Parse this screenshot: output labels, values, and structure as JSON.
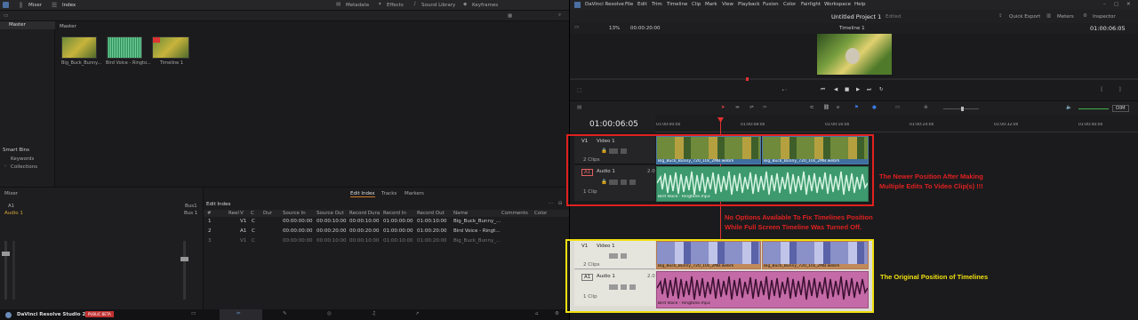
{
  "left_app": {
    "topbar": {
      "mixer": "Mixer",
      "index": "Index",
      "metadata": "Metadata",
      "effects": "Effects",
      "sound_library": "Sound Library",
      "keyframes": "Keyframes"
    },
    "master": "Master",
    "media_header": "Master",
    "clips": [
      {
        "name": "Big_Buck_Bunny..."
      },
      {
        "name": "Bird Voice - Ringto..."
      },
      {
        "name": "Timeline 1"
      }
    ],
    "smart_bins": "Smart Bins",
    "keywords": "Keywords",
    "collections": "Collections",
    "mixer_label": "Mixer",
    "a1": "A1",
    "audio1": "Audio 1",
    "bus1": "Bus1",
    "bus1b": "Bus 1",
    "edit_index": {
      "title": "Edit Index",
      "tabs": [
        "Edit Index",
        "Tracks",
        "Markers"
      ],
      "columns": [
        "#",
        "Reel",
        "V",
        "C",
        "Dur",
        "Source In",
        "Source Out",
        "Record Duratio",
        "Record In",
        "Record Out",
        "Name",
        "Comments",
        "Color"
      ],
      "rows": [
        [
          "1",
          "",
          "V1",
          "C",
          "",
          "00:00:00:00",
          "00:00:10:00",
          "00:00:10:00",
          "01:00:00:00",
          "01:00:10:00",
          "Big_Buck_Bunny_..."
        ],
        [
          "2",
          "",
          "A1",
          "C",
          "",
          "00:00:00:00",
          "00:00:20:00",
          "00:00:20:00",
          "01:00:00:00",
          "01:00:20:00",
          "Bird Voice - Ringt..."
        ],
        [
          "3",
          "",
          "V1",
          "C",
          "",
          "00:00:00:00",
          "00:00:10:00",
          "00:00:10:00",
          "01:00:10:00",
          "01:00:20:00",
          "Big_Buck_Bunny_..."
        ]
      ]
    },
    "brand": "DaVinci Resolve Studio 20",
    "badge": "PUBLIC BETA"
  },
  "right_app": {
    "menu": [
      "DaVinci Resolve",
      "File",
      "Edit",
      "Trim",
      "Timeline",
      "Clip",
      "Mark",
      "View",
      "Playback",
      "Fusion",
      "Color",
      "Fairlight",
      "Workspace",
      "Help"
    ],
    "project_title": "Untitled Project 1",
    "edited": "Edited",
    "quick_export": "Quick Export",
    "meters": "Meters",
    "inspector": "Inspector",
    "zoom": "13%",
    "src_tc": "00:00:20:00",
    "timeline_name": "Timeline 1",
    "rec_tc": "01:00:06:05",
    "big_tc": "01:00:06:05",
    "ruler": [
      "01:00:00:00",
      "01:00:08:00",
      "01:00:16:00",
      "01:00:24:00",
      "01:00:32:00",
      "01:00:40:00"
    ],
    "dim": "DIM",
    "tracks_new": {
      "v1": "V1",
      "video1": "Video 1",
      "clips2": "2 Clips",
      "a1": "A1",
      "audio1": "Audio 1",
      "ch": "2.0",
      "clips1": "1 Clip",
      "clipA": "Big_Buck_Bunny_720_10s_2MB.webm",
      "clipB": "Big_Buck_Bunny_720_10s_2MB.webm",
      "audio_clip": "Bird Voice - Ringtone.mp3"
    },
    "tracks_old": {
      "v1": "V1",
      "video1": "Video 1",
      "clips2": "2 Clips",
      "a1": "A1",
      "audio1": "Audio 1",
      "ch": "2.0",
      "clips1": "1 Clip",
      "clipA": "Big_Buck_Bunny_720_10s_2MB.webm",
      "clipB": "Big_Buck_Bunny_720_10s_2MB.webm",
      "audio_clip": "Bird Voice - Ringtone.mp3"
    }
  },
  "annotations": {
    "newer_line1": "The Newer Position After Making",
    "newer_line2": "Multiple Edits To Video Clip(s) !!!",
    "noopt_line1": "No Options Available To Fix Timelines Position",
    "noopt_line2": "While Full Screen Timeline Was Turned Off.",
    "original": "The Original Position of Timelines"
  },
  "colors": {
    "red": "#e02020",
    "yellow": "#f0e010",
    "playhead": "#e03030",
    "audio_green": "#3d9a6e",
    "audio_pink": "#c46aa6",
    "clip_blue": "#3f6f9f",
    "clip_orange": "#b5784a"
  }
}
